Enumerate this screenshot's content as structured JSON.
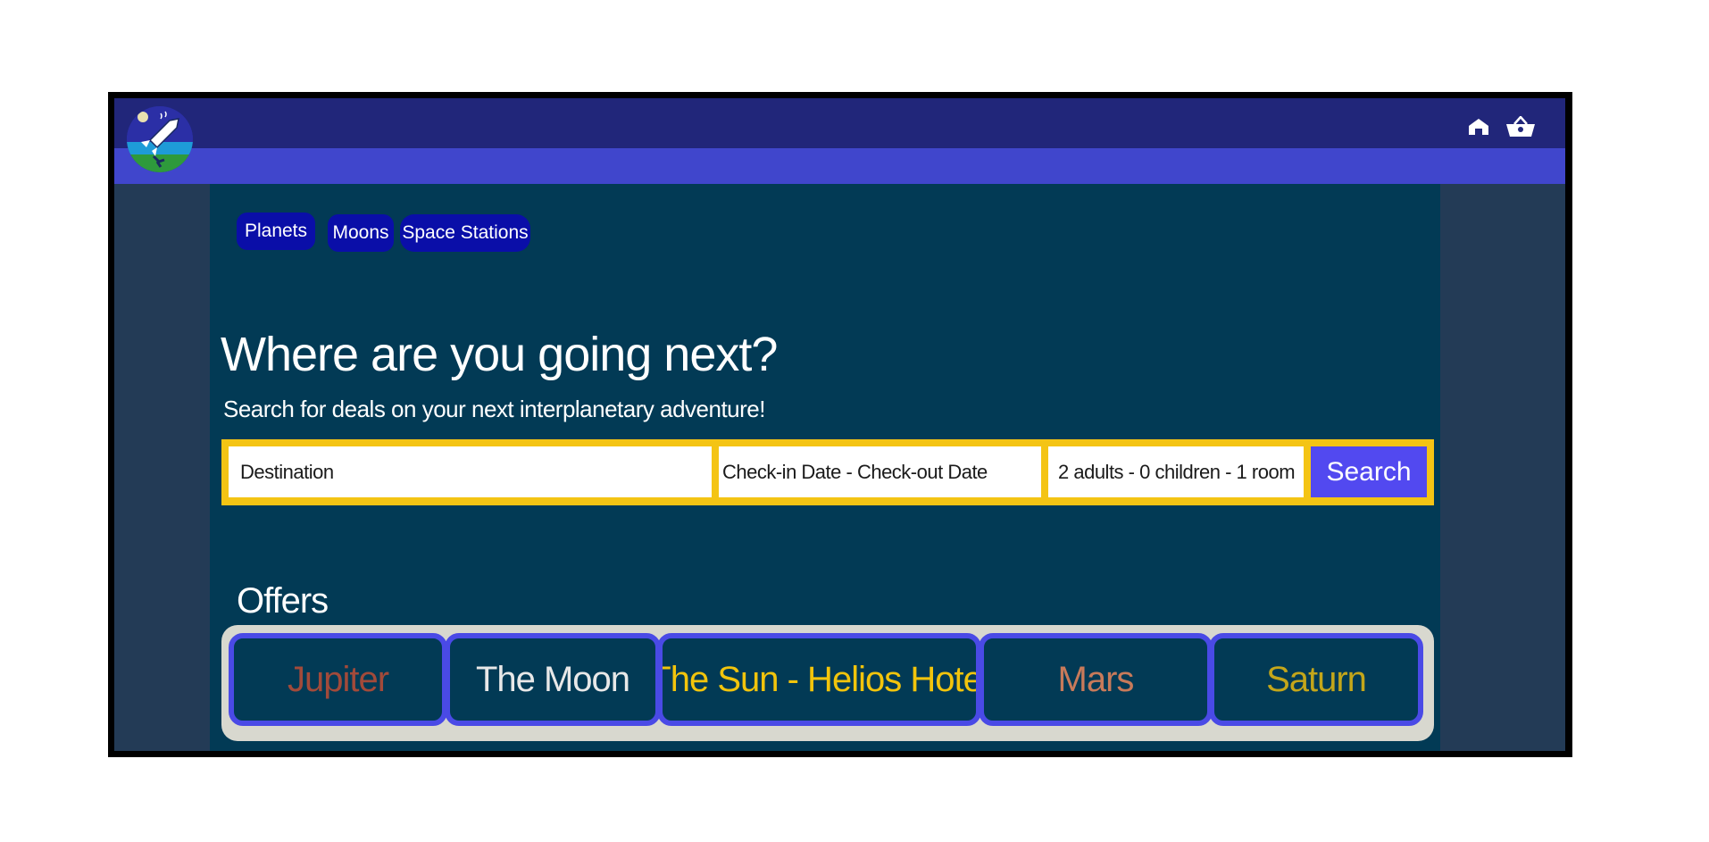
{
  "header": {
    "logo_icon": "rocket-logo-icon",
    "icons": [
      "home-icon",
      "basket-icon"
    ]
  },
  "categories": [
    "Planets",
    "Moons",
    "Space Stations"
  ],
  "hero": {
    "title": "Where are you going next?",
    "subtitle": "Search for deals on your next interplanetary adventure!"
  },
  "search": {
    "destination": "Destination",
    "dates": "Check-in Date - Check-out Date",
    "guests": "2 adults - 0 children - 1 room",
    "button": "Search"
  },
  "offers": {
    "title": "Offers",
    "items": [
      {
        "label": "Jupiter",
        "color": "#a24a3a"
      },
      {
        "label": "The Moon",
        "color": "#e8e8e8"
      },
      {
        "label": "The Sun - Helios Hotel",
        "color": "#f2c40c"
      },
      {
        "label": "Mars",
        "color": "#c87a5a"
      },
      {
        "label": "Saturn",
        "color": "#c4a61a"
      }
    ]
  },
  "colors": {
    "topbar": "#21267a",
    "subbar": "#4046cc",
    "content_bg": "#023a55",
    "search_accent": "#f4c414",
    "search_button": "#5249f0"
  }
}
